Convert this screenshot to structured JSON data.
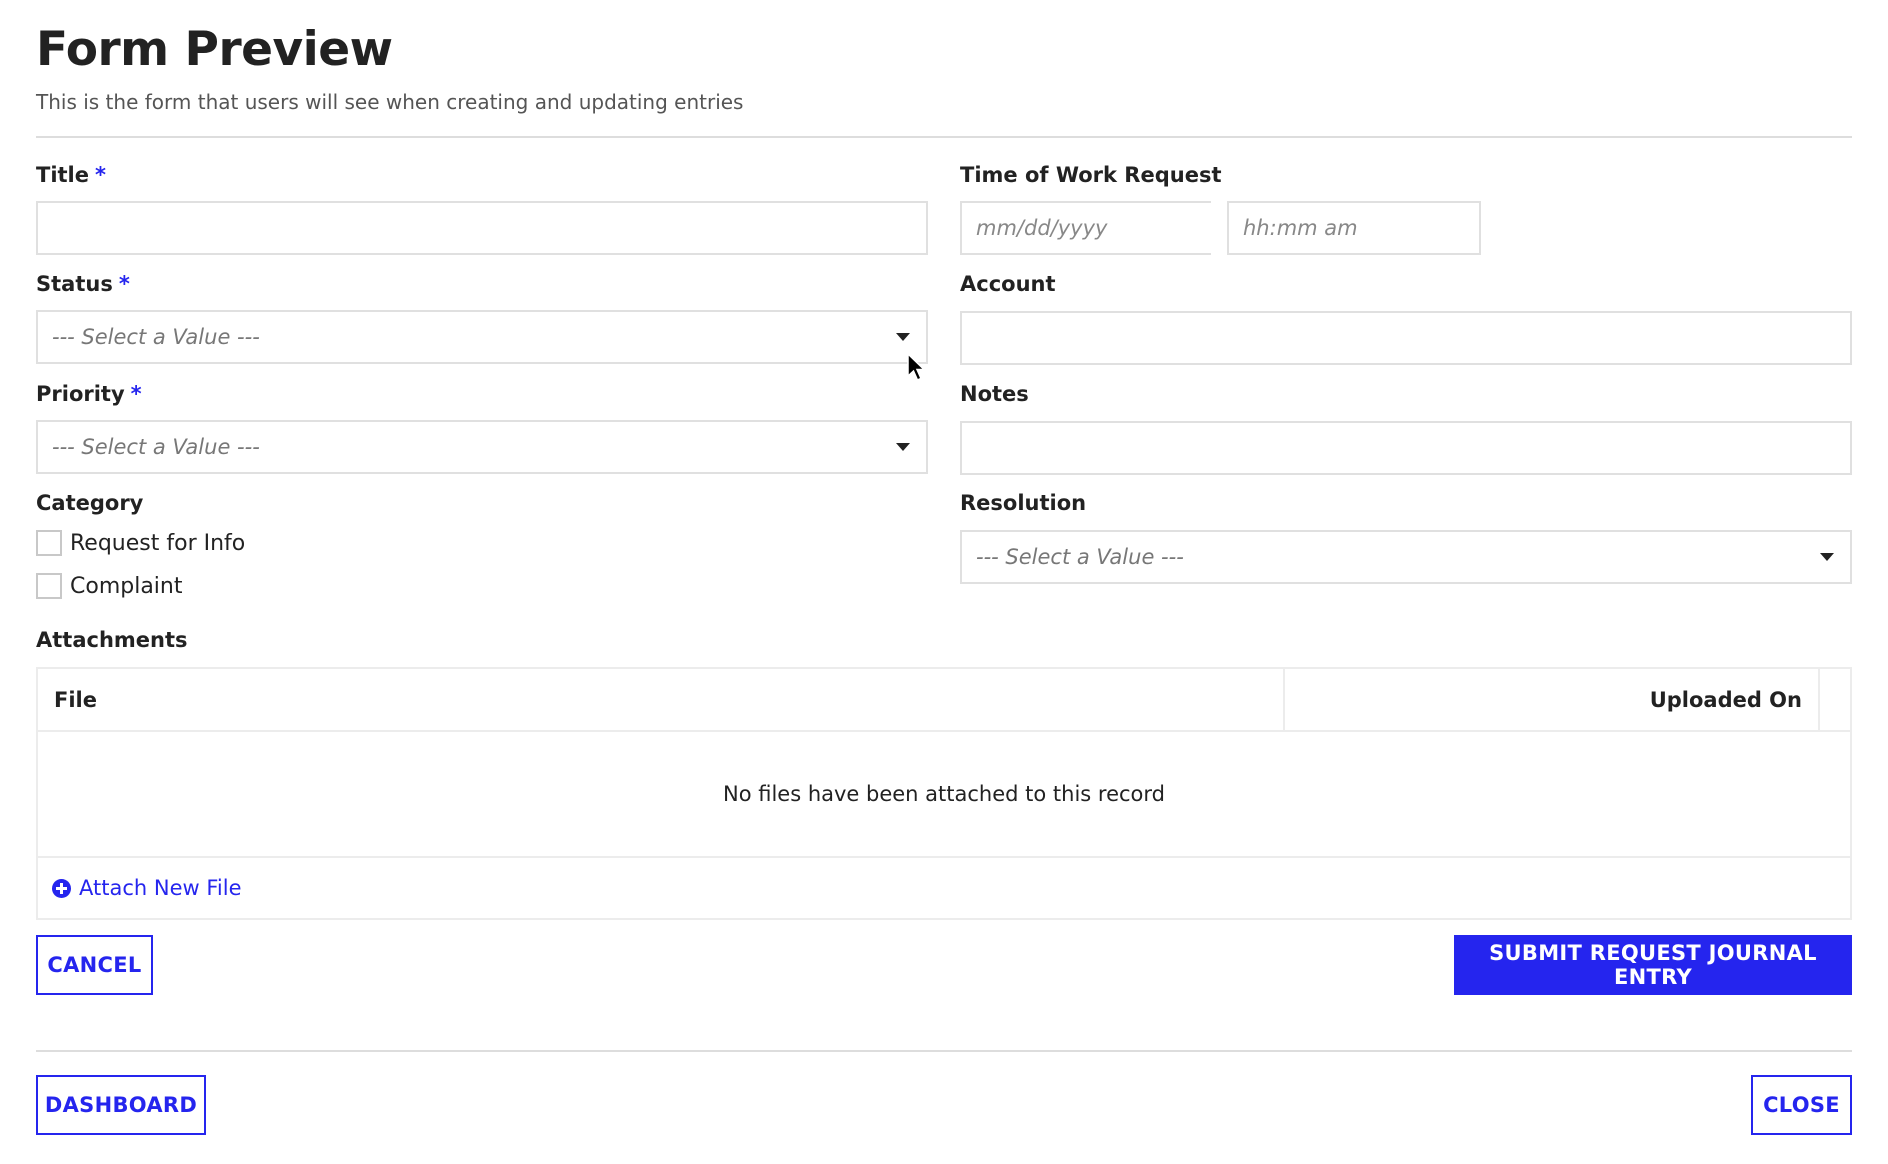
{
  "header": {
    "title": "Form Preview",
    "subtitle": "This is the form that users will see when creating and updating entries"
  },
  "brand_color": "#2525EE",
  "fields": {
    "title": {
      "label": "Title",
      "required_marker": "*",
      "value": ""
    },
    "status": {
      "label": "Status",
      "required_marker": "*",
      "selected": "--- Select a Value ---"
    },
    "priority": {
      "label": "Priority",
      "required_marker": "*",
      "selected": "--- Select a Value ---"
    },
    "category": {
      "label": "Category",
      "options": [
        {
          "label": "Request for Info",
          "checked": false
        },
        {
          "label": "Complaint",
          "checked": false
        }
      ]
    },
    "time_of_work_request": {
      "label": "Time of Work Request",
      "date_placeholder": "mm/dd/yyyy",
      "time_placeholder": "hh:mm am",
      "calendar_icon": "calendar-icon"
    },
    "account": {
      "label": "Account",
      "value": ""
    },
    "notes": {
      "label": "Notes",
      "value": ""
    },
    "resolution": {
      "label": "Resolution",
      "selected": "--- Select a Value ---"
    }
  },
  "attachments": {
    "label": "Attachments",
    "columns": [
      "File",
      "Uploaded On"
    ],
    "rows": [],
    "empty_message": "No files have been attached to this record",
    "attach_link": "Attach New File",
    "attach_icon": "plus-circle-icon"
  },
  "actions": {
    "cancel": "CANCEL",
    "submit": "SUBMIT REQUEST JOURNAL ENTRY",
    "dashboard": "DASHBOARD",
    "close": "CLOSE"
  }
}
